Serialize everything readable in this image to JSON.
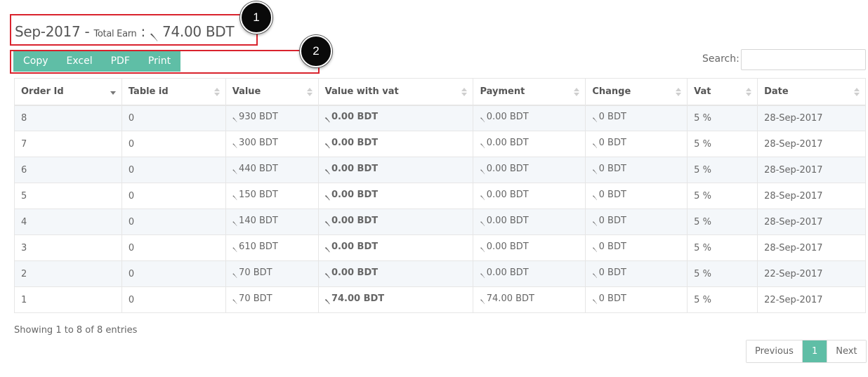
{
  "header": {
    "month": "Sep-2017",
    "separator": " - ",
    "total_label": "Total Earn",
    "colon": " : ",
    "currency_symbol": "৲",
    "total_value": "74.00 BDT"
  },
  "annotations": [
    "1",
    "2"
  ],
  "export_buttons": [
    "Copy",
    "Excel",
    "PDF",
    "Print"
  ],
  "search": {
    "label": "Search:",
    "value": ""
  },
  "table": {
    "columns": [
      "Order Id",
      "Table id",
      "Value",
      "Value with vat",
      "Payment",
      "Change",
      "Vat",
      "Date"
    ],
    "currency_symbol": "৲",
    "rows": [
      [
        "8",
        "0",
        "930 BDT",
        "0.00 BDT",
        "0.00 BDT",
        "0 BDT",
        "5 %",
        "28-Sep-2017"
      ],
      [
        "7",
        "0",
        "300 BDT",
        "0.00 BDT",
        "0.00 BDT",
        "0 BDT",
        "5 %",
        "28-Sep-2017"
      ],
      [
        "6",
        "0",
        "440 BDT",
        "0.00 BDT",
        "0.00 BDT",
        "0 BDT",
        "5 %",
        "28-Sep-2017"
      ],
      [
        "5",
        "0",
        "150 BDT",
        "0.00 BDT",
        "0.00 BDT",
        "0 BDT",
        "5 %",
        "28-Sep-2017"
      ],
      [
        "4",
        "0",
        "140 BDT",
        "0.00 BDT",
        "0.00 BDT",
        "0 BDT",
        "5 %",
        "28-Sep-2017"
      ],
      [
        "3",
        "0",
        "610 BDT",
        "0.00 BDT",
        "0.00 BDT",
        "0 BDT",
        "5 %",
        "28-Sep-2017"
      ],
      [
        "2",
        "0",
        "70 BDT",
        "0.00 BDT",
        "0.00 BDT",
        "0 BDT",
        "5 %",
        "22-Sep-2017"
      ],
      [
        "1",
        "0",
        "70 BDT",
        "74.00 BDT",
        "74.00 BDT",
        "0 BDT",
        "5 %",
        "22-Sep-2017"
      ]
    ]
  },
  "footer": {
    "info": "Showing 1 to 8 of 8 entries",
    "pagination": {
      "previous": "Previous",
      "current": "1",
      "next": "Next"
    }
  },
  "colors": {
    "accent": "#5fbea6",
    "highlight_border": "#d9232d",
    "badge": "#0a0a0a"
  }
}
